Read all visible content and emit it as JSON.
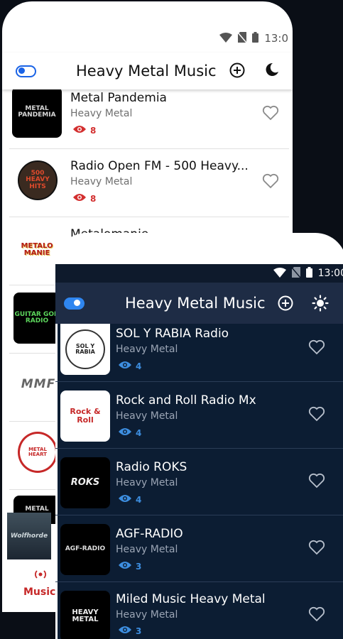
{
  "light_app": {
    "status": {
      "time": "13:0"
    },
    "title": "Heavy Metal Music",
    "stations": [
      {
        "name": "Metal Pandemia",
        "genre": "Heavy Metal",
        "views": "8",
        "logo": "METAL PANDEMIA"
      },
      {
        "name": "Radio Open FM - 500 Heavy...",
        "genre": "Heavy Metal",
        "views": "8",
        "logo": "500 HEAVY HITS"
      },
      {
        "name": "Metalomanie",
        "genre": "",
        "views": "",
        "logo": "METALO MANIE"
      },
      {
        "name": "",
        "genre": "",
        "views": "",
        "logo": "GUITAR GOD RADIO"
      },
      {
        "name": "",
        "genre": "",
        "views": "",
        "logo": "MMF"
      },
      {
        "name": "",
        "genre": "",
        "views": "",
        "logo": "METAL HEART"
      },
      {
        "name": "",
        "genre": "",
        "views": "",
        "logo": "METAL"
      }
    ],
    "now_playing_logo": "Wolfhorde",
    "bottom_nav": {
      "label": "Music",
      "icon": "radio-broadcast-icon"
    },
    "colors": {
      "accent": "#1a63e6",
      "views": "#d32f2f"
    }
  },
  "dark_app": {
    "status": {
      "time": "13:00"
    },
    "title": "Heavy Metal Music",
    "stations": [
      {
        "name": "SOL Y RABIA Radio",
        "genre": "Heavy Metal",
        "views": "4",
        "logo": "SOL Y RABIA"
      },
      {
        "name": "Rock and Roll Radio Mx",
        "genre": "Heavy Metal",
        "views": "4",
        "logo": "Rock & Roll"
      },
      {
        "name": "Radio ROKS",
        "genre": "Heavy Metal",
        "views": "4",
        "logo": "ROKS"
      },
      {
        "name": "AGF-RADIO",
        "genre": "Heavy Metal",
        "views": "3",
        "logo": "AGF-RADIO"
      },
      {
        "name": "Miled Music Heavy Metal",
        "genre": "Heavy Metal",
        "views": "3",
        "logo": "HEAVY METAL"
      }
    ],
    "colors": {
      "background": "#0c1d33",
      "appbar": "#1e2c45",
      "views": "#3d8ee0"
    }
  }
}
